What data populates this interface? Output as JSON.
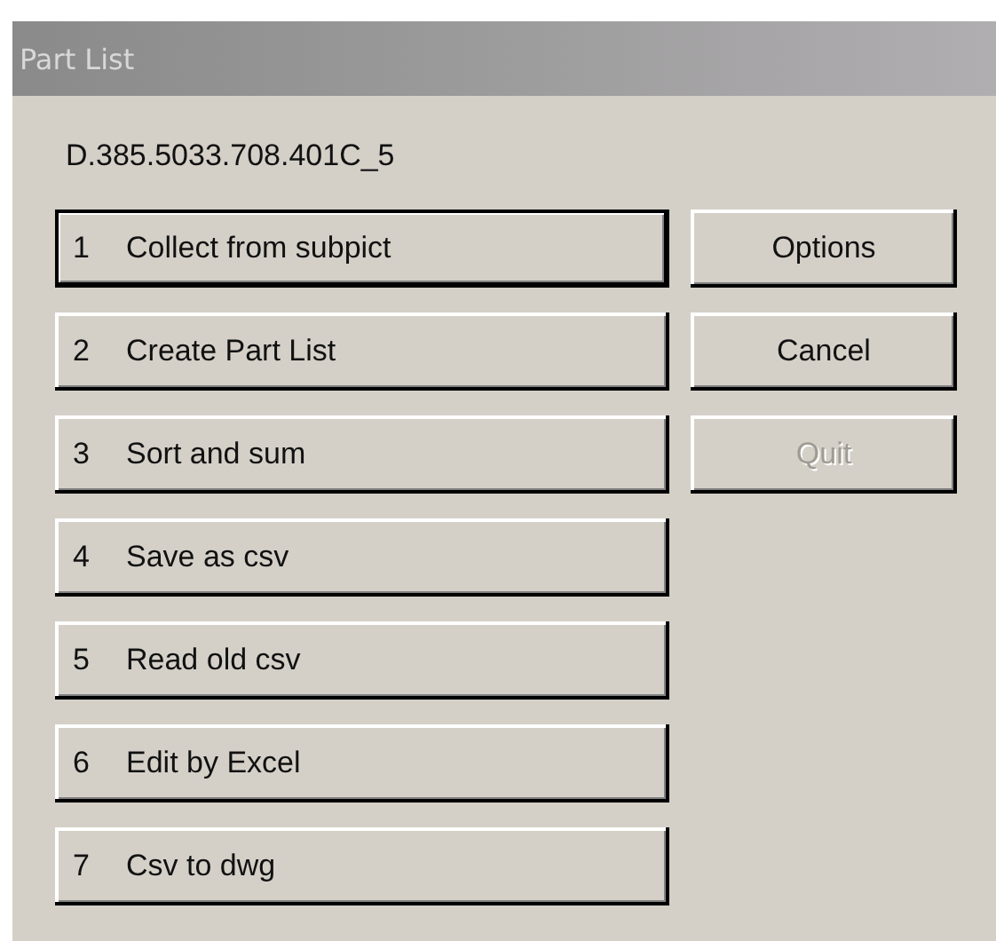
{
  "window": {
    "title": "Part List"
  },
  "drawing_number": "D.385.5033.708.401C_5",
  "steps": [
    {
      "number": "1",
      "label": "Collect from subpict",
      "default": true
    },
    {
      "number": "2",
      "label": "Create Part List",
      "default": false
    },
    {
      "number": "3",
      "label": "Sort and sum",
      "default": false
    },
    {
      "number": "4",
      "label": "Save as csv",
      "default": false
    },
    {
      "number": "5",
      "label": "Read old csv",
      "default": false
    },
    {
      "number": "6",
      "label": "Edit by Excel",
      "default": false
    },
    {
      "number": "7",
      "label": "Csv to dwg",
      "default": false
    }
  ],
  "buttons": [
    {
      "label": "Options",
      "disabled": false
    },
    {
      "label": "Cancel",
      "disabled": false
    },
    {
      "label": "Quit",
      "disabled": true
    }
  ]
}
